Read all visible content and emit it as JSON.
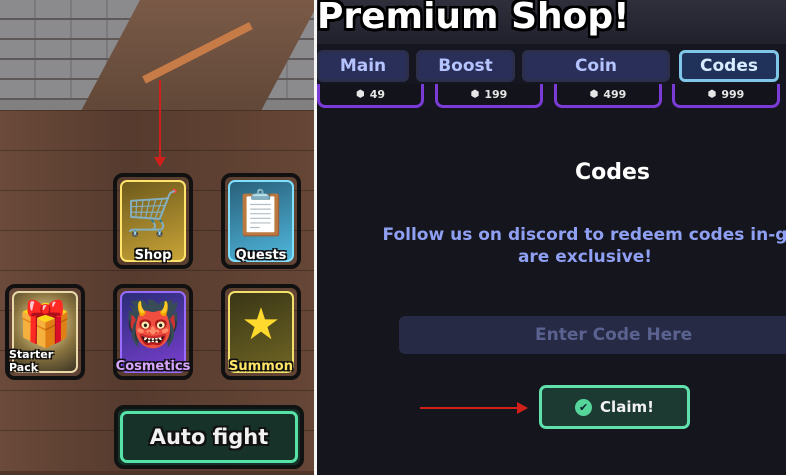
{
  "game_hud": {
    "buttons": [
      {
        "label": "Shop",
        "icon": "shopping-cart-icon"
      },
      {
        "label": "Quests",
        "icon": "clipboard-check-icon"
      },
      {
        "label": "Starter Pack",
        "icon": "gift-icon"
      },
      {
        "label": "Cosmetics",
        "icon": "demon-mask-icon"
      },
      {
        "label": "Summon",
        "icon": "star-icon"
      }
    ],
    "auto_fight_label": "Auto fight"
  },
  "shop": {
    "title": "Premium Shop!",
    "tabs": [
      {
        "label": "Main",
        "active": false
      },
      {
        "label": "Boost",
        "active": false
      },
      {
        "label": "Coin",
        "active": false
      },
      {
        "label": "Codes",
        "active": true
      }
    ],
    "prices": [
      "49",
      "199",
      "499",
      "999"
    ],
    "section_title": "Codes",
    "description_line1": "Follow us on discord to redeem codes in-g",
    "description_line2": "are exclusive!",
    "code_input_placeholder": "Enter Code Here",
    "claim_label": "Claim!"
  },
  "colors": {
    "annotation_arrow": "#d0201c",
    "active_tab_border": "#7fc6e9",
    "claim_border": "#5fe0ad",
    "description_text": "#8f9ff2"
  }
}
